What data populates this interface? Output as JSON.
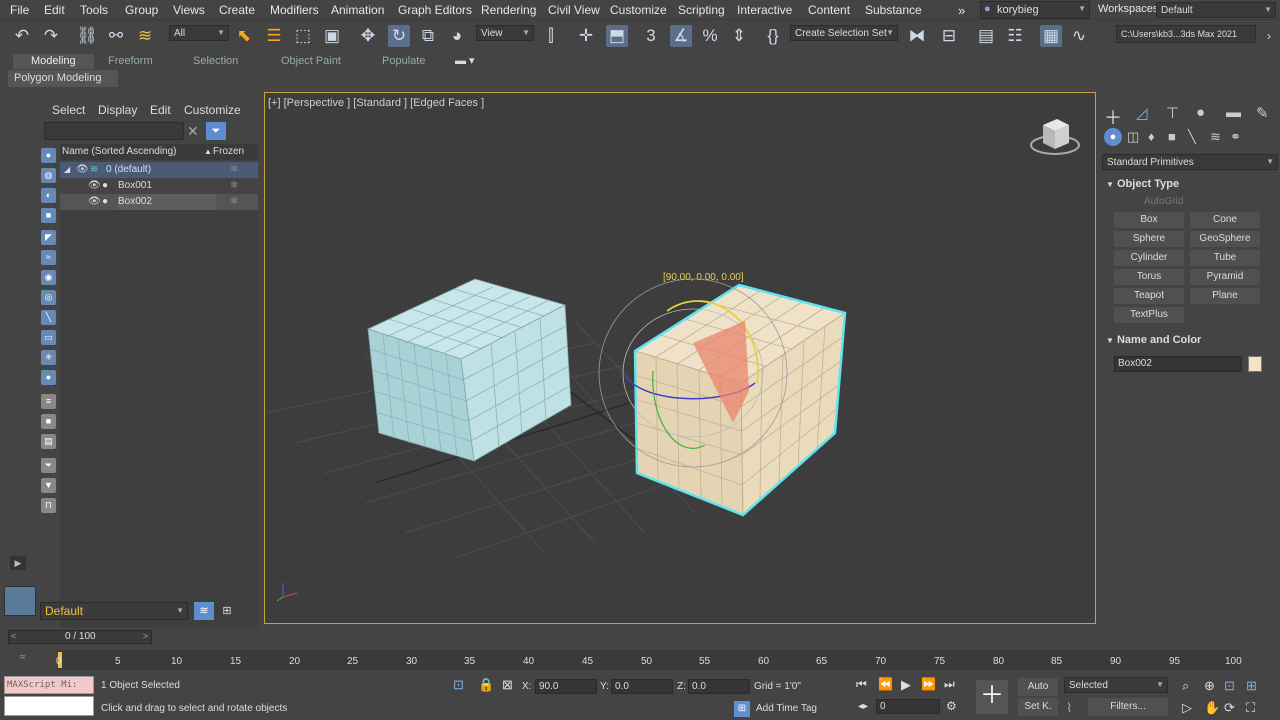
{
  "menubar": {
    "items": [
      "File",
      "Edit",
      "Tools",
      "Group",
      "Views",
      "Create",
      "Modifiers",
      "Animation",
      "Graph Editors",
      "Rendering",
      "Civil View",
      "Customize",
      "Scripting",
      "Interactive",
      "Content",
      "Substance"
    ],
    "user": "korybieg",
    "workspaces_label": "Workspaces:",
    "workspace_value": "Default"
  },
  "toolbar": {
    "filter_value": "All",
    "view_value": "View",
    "selection_set": "Create Selection Set",
    "path": "C:\\Users\\kb3...3ds Max 2021"
  },
  "ribbon": {
    "tabs": [
      "Modeling",
      "Freeform",
      "Selection",
      "Object Paint",
      "Populate"
    ],
    "active": "Modeling",
    "panel": "Polygon Modeling"
  },
  "explorer": {
    "tabs": [
      "Select",
      "Display",
      "Edit",
      "Customize"
    ],
    "col_name": "Name (Sorted Ascending)",
    "col_frozen": "Frozen",
    "rows": [
      "0 (default)",
      "Box001",
      "Box002"
    ],
    "layer_value": "Default"
  },
  "viewport": {
    "label": "[+] [Perspective ] [Standard ] [Edged Faces ]",
    "rotate_readout": "[90.00, 0.00, 0.00]"
  },
  "cmdpanel": {
    "category": "Standard Primitives",
    "object_type": "Object Type",
    "autogrid": "AutoGrid",
    "primitives": [
      "Box",
      "Cone",
      "Sphere",
      "GeoSphere",
      "Cylinder",
      "Tube",
      "Torus",
      "Pyramid",
      "Teapot",
      "Plane",
      "TextPlus"
    ],
    "name_color": "Name and Color",
    "object_name": "Box002",
    "object_color": "#f3e3c2"
  },
  "timeline": {
    "frame": "0 / 100",
    "ticks": [
      "0",
      "5",
      "10",
      "15",
      "20",
      "25",
      "30",
      "35",
      "40",
      "45",
      "50",
      "55",
      "60",
      "65",
      "70",
      "75",
      "80",
      "85",
      "90",
      "95",
      "100"
    ]
  },
  "status": {
    "maxscript": "MAXScript Mi:",
    "selected": "1 Object Selected",
    "prompt": "Click and drag to select and rotate objects",
    "x_label": "X:",
    "x_value": "90.0",
    "y_label": "Y:",
    "y_value": "0.0",
    "z_label": "Z:",
    "z_value": "0.0",
    "grid": "Grid = 1'0\"",
    "add_time_tag": "Add Time Tag",
    "auto": "Auto",
    "selected_dd": "Selected",
    "set_key": "Set K.",
    "filters": "Filters...",
    "frame_field": "0"
  }
}
